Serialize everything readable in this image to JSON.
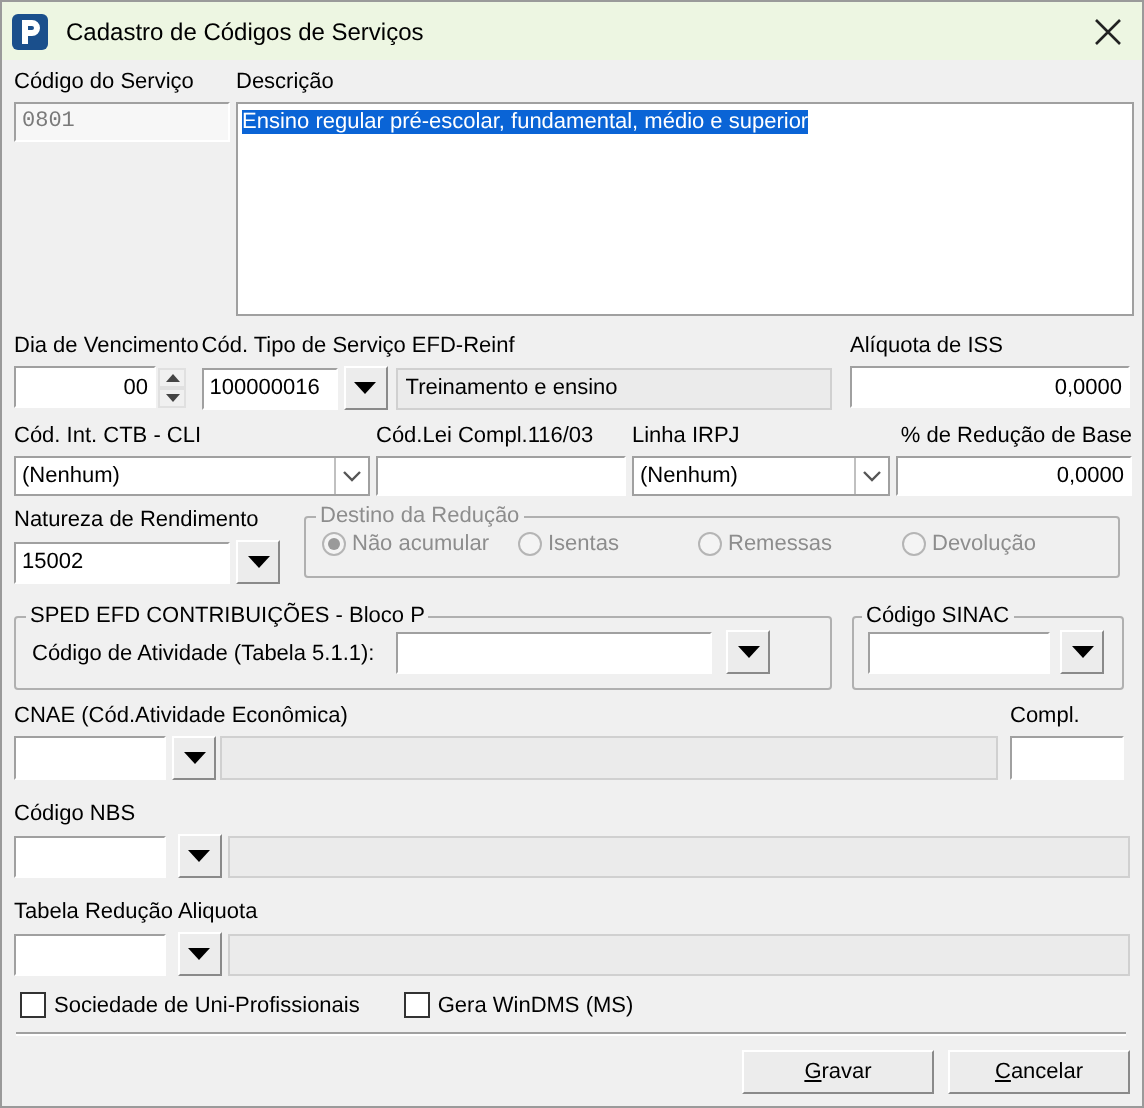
{
  "window": {
    "title": "Cadastro de Códigos de Serviços"
  },
  "codigo_servico": {
    "label": "Código do Serviço",
    "value": "0801",
    "disabled": true
  },
  "descricao": {
    "label": "Descrição",
    "value": "Ensino regular pré-escolar, fundamental, médio e superior",
    "selected": true
  },
  "dia_vencimento": {
    "label": "Dia de Vencimento",
    "value": "00"
  },
  "tipo_servico": {
    "label": "Cód. Tipo de Serviço EFD-Reinf",
    "value": "100000016",
    "description": "Treinamento e ensino"
  },
  "aliquota_iss": {
    "label": "Alíquota de ISS",
    "value": "0,0000"
  },
  "cod_ctb": {
    "label": "Cód. Int. CTB - CLI",
    "value": "(Nenhum)"
  },
  "lei_compl": {
    "label": "Cód.Lei Compl.116/03"
  },
  "linha_irpj": {
    "label": "Linha IRPJ",
    "value": "(Nenhum)"
  },
  "reducao_base": {
    "label": "% de Redução de Base",
    "value": "0,0000"
  },
  "natureza": {
    "label": "Natureza de Rendimento",
    "value": "15002"
  },
  "destino_reducao": {
    "title": "Destino da Redução",
    "disabled": true,
    "options": [
      {
        "label": "Não acumular",
        "selected": true
      },
      {
        "label": "Isentas",
        "selected": false
      },
      {
        "label": "Remessas",
        "selected": false
      },
      {
        "label": "Devolução",
        "selected": false
      }
    ]
  },
  "sped": {
    "title": "SPED EFD CONTRIBUIÇÕES - Bloco P",
    "label": "Código de Atividade (Tabela 5.1.1):"
  },
  "sinac": {
    "title": "Código SINAC"
  },
  "cnae": {
    "label": "CNAE (Cód.Atividade Econômica)",
    "compl_label": "Compl."
  },
  "nbs": {
    "label": "Código NBS"
  },
  "tabela_reducao": {
    "label": "Tabela Redução Aliquota"
  },
  "checkboxes": [
    {
      "label": "Sociedade de Uni-Profissionais",
      "checked": false
    },
    {
      "label": "Gera WinDMS (MS)",
      "checked": false
    }
  ],
  "buttons": [
    {
      "label": "Gravar"
    },
    {
      "label": "Cancelar"
    }
  ]
}
